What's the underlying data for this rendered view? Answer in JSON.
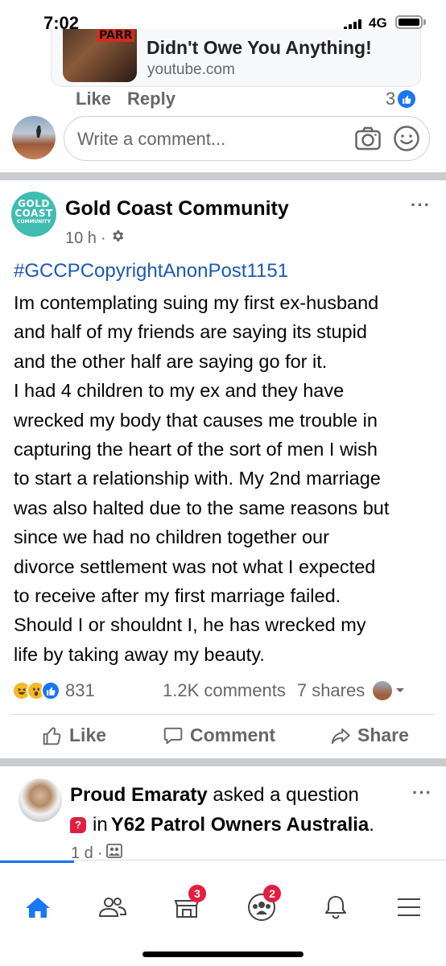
{
  "status_bar": {
    "time": "7:02",
    "network": "4G",
    "battery_level": 1.0
  },
  "link_preview": {
    "thumbnail_text": "PARR",
    "title": "Didn't Owe You Anything!",
    "domain": "youtube.com"
  },
  "comment": {
    "like_label": "Like",
    "reply_label": "Reply",
    "reaction_count": "3"
  },
  "composer": {
    "placeholder": "Write a comment..."
  },
  "post": {
    "page_logo_line1": "GOLD",
    "page_logo_line2": "COAST",
    "page_logo_line3": "COMMUNITY",
    "page_name": "Gold Coast Community",
    "time": "10 h",
    "hashtag": "#GCCPCopyrightAnonPost1151",
    "body_lines": [
      "Im contemplating suing my first ex-husband",
      "and half of my friends are saying its stupid",
      "and the other half are saying go for it.",
      "I had 4 children to my ex and they have",
      "wrecked my body that causes me trouble in",
      "capturing the heart of the sort of men I wish",
      "to start a relationship with. My 2nd marriage",
      "was also halted due to the same reasons but",
      "since we had no children together our",
      "divorce settlement was not what I expected",
      "to receive after my first marriage failed.",
      "Should I or shouldnt I, he has wrecked my",
      "life by taking away my beauty."
    ],
    "reaction_count": "831",
    "comments": "1.2K comments",
    "shares": "7 shares",
    "actions": {
      "like": "Like",
      "comment": "Comment",
      "share": "Share"
    }
  },
  "next_post": {
    "user_name": "Proud Emaraty",
    "action_text": "asked a question",
    "in_text": "in",
    "group_name": "Y62 Patrol Owners Australia",
    "group_suffix": ".",
    "time": "1 d"
  },
  "tab_bar": {
    "marketplace_badge": "3",
    "groups_badge": "2"
  }
}
